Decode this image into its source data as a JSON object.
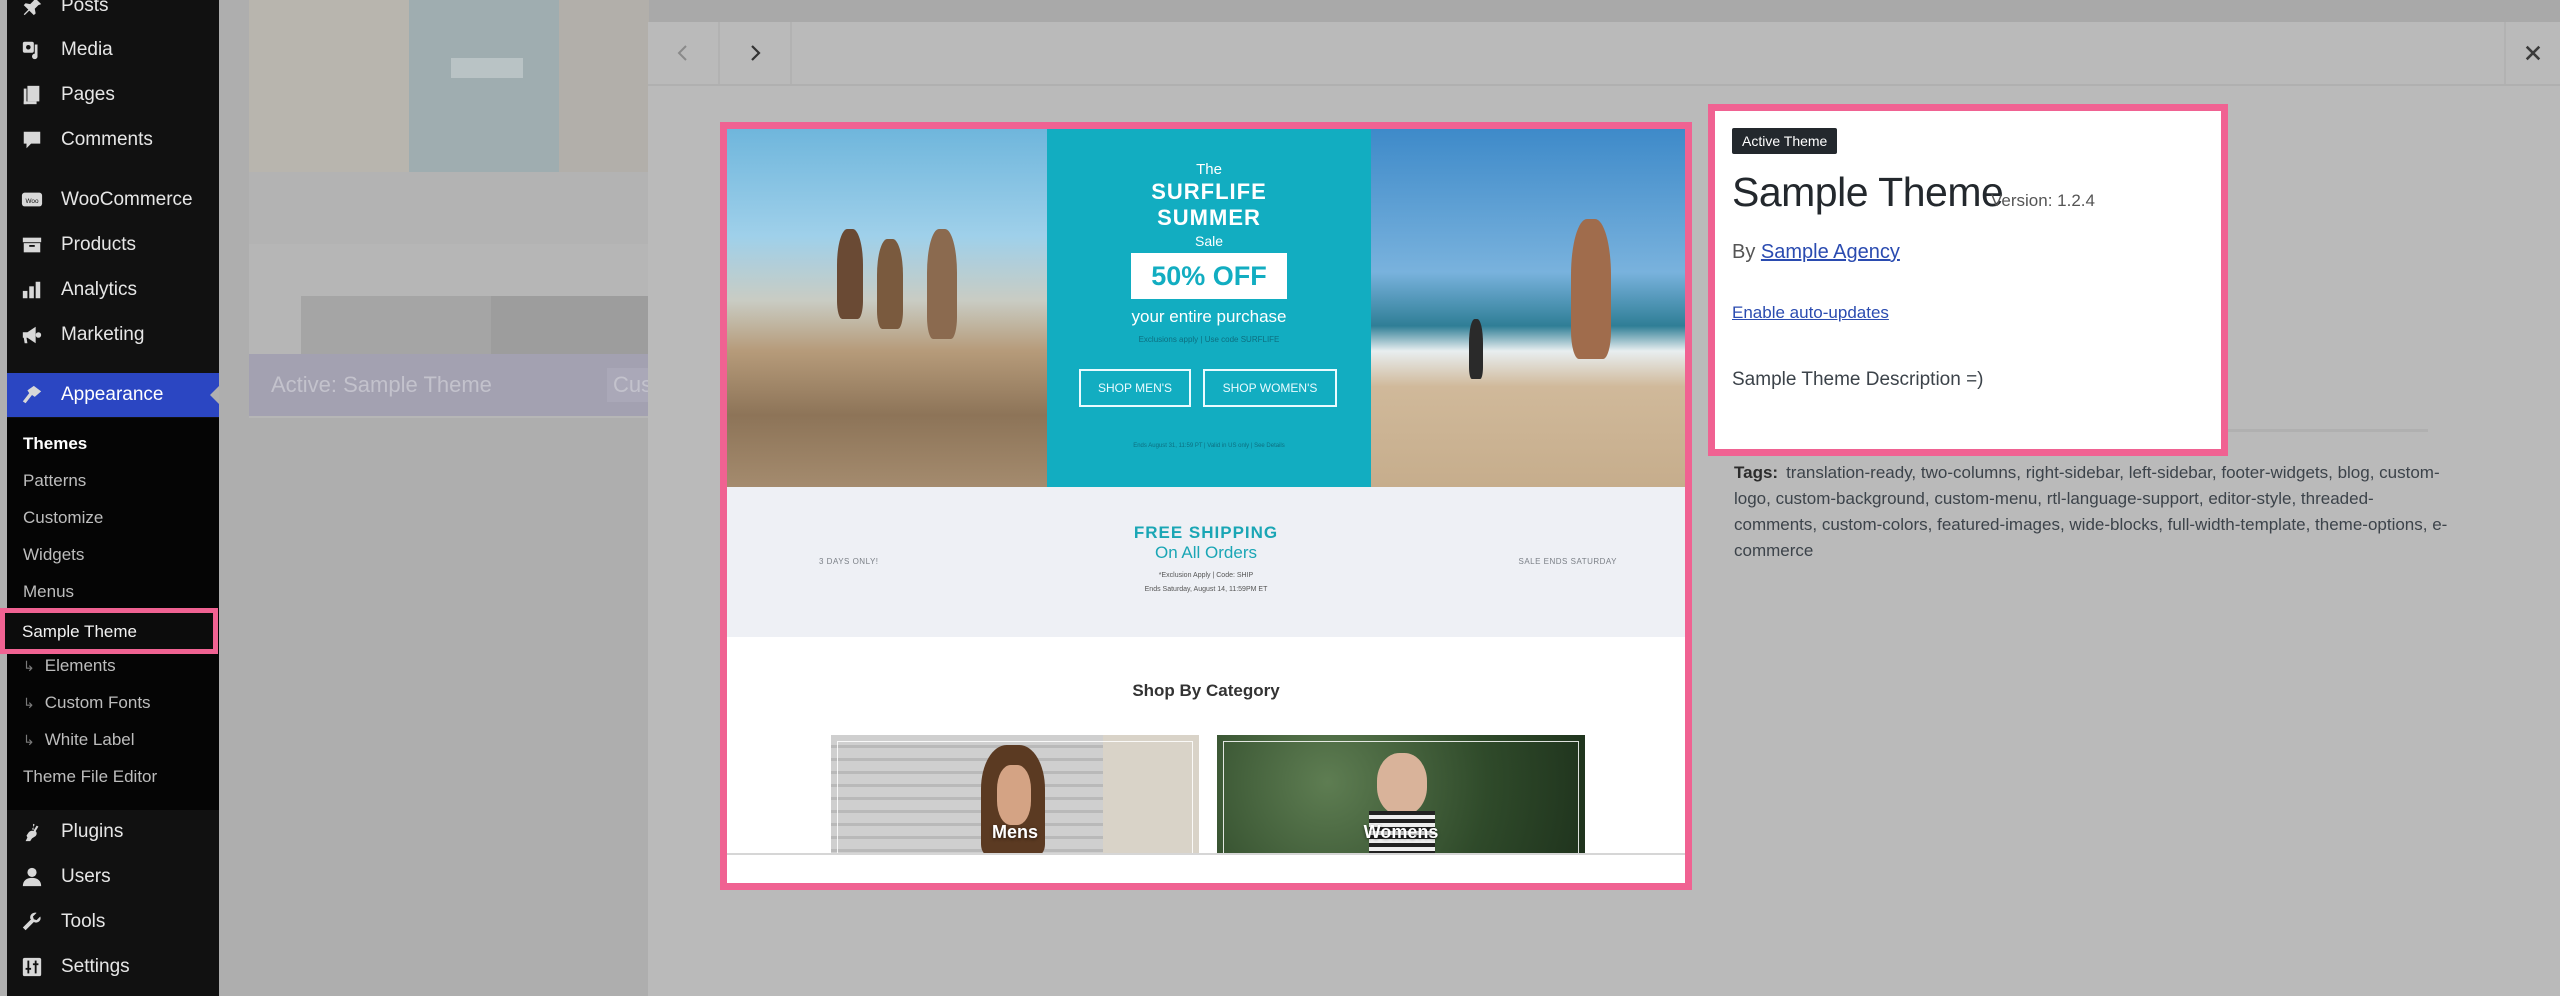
{
  "sidebar": {
    "items": [
      {
        "label": "Posts",
        "icon": "pin-icon"
      },
      {
        "label": "Media",
        "icon": "media-icon"
      },
      {
        "label": "Pages",
        "icon": "pages-icon"
      },
      {
        "label": "Comments",
        "icon": "comment-icon"
      },
      {
        "label": "WooCommerce",
        "icon": "woo-icon"
      },
      {
        "label": "Products",
        "icon": "archive-icon"
      },
      {
        "label": "Analytics",
        "icon": "bar-chart-icon"
      },
      {
        "label": "Marketing",
        "icon": "megaphone-icon"
      },
      {
        "label": "Appearance",
        "icon": "paintbrush-icon"
      },
      {
        "label": "Plugins",
        "icon": "plug-icon"
      },
      {
        "label": "Users",
        "icon": "user-icon"
      },
      {
        "label": "Tools",
        "icon": "wrench-icon"
      },
      {
        "label": "Settings",
        "icon": "sliders-icon"
      }
    ],
    "submenu": [
      {
        "label": "Themes"
      },
      {
        "label": "Patterns"
      },
      {
        "label": "Customize"
      },
      {
        "label": "Widgets"
      },
      {
        "label": "Menus"
      },
      {
        "label": "Sample Theme"
      },
      {
        "label": "Elements",
        "hook": "↳"
      },
      {
        "label": "Custom Fonts",
        "hook": "↳"
      },
      {
        "label": "White Label",
        "hook": "↳"
      },
      {
        "label": "Theme File Editor"
      }
    ]
  },
  "background": {
    "card_title": "Active: Sample Theme",
    "card_button": "Customize"
  },
  "modal": {
    "prev_icon": "chevron-left-icon",
    "next_icon": "chevron-right-icon",
    "close_icon": "close-icon",
    "preview": {
      "hero": {
        "line1": "The",
        "line2": "SURFLIFE",
        "line3": "SUMMER",
        "line4": "Sale",
        "offer": "50% OFF",
        "subline": "your entire purchase",
        "exclusions": "Exclusions apply | Use code SURFLIFE",
        "shop_mens": "SHOP MEN'S",
        "shop_womens": "SHOP WOMEN'S",
        "ends": "Ends August 31, 11:59 PT | Valid in US only | See Details"
      },
      "shipping": {
        "left": "3 DAYS ONLY!",
        "title": "FREE SHIPPING",
        "subtitle": "On All Orders",
        "note1": "*Exclusion Apply | Code: SHIP",
        "note2": "Ends Saturday, August 14, 11:59PM ET",
        "right": "SALE ENDS SATURDAY"
      },
      "category_title": "Shop By Category",
      "categories": [
        {
          "label": "Mens"
        },
        {
          "label": "Womens"
        }
      ]
    },
    "details": {
      "badge": "Active Theme",
      "name": "Sample Theme",
      "version": "Version: 1.2.4",
      "author_prefix": "By",
      "author": "Sample Agency",
      "auto_updates": "Enable auto-updates",
      "description": "Sample Theme Description =)",
      "tags_label": "Tags:",
      "tags": "translation-ready, two-columns, right-sidebar, left-sidebar, footer-widgets, blog, custom-logo, custom-background, custom-menu, rtl-language-support, editor-style, threaded-comments, custom-colors, featured-images, wide-blocks, full-width-template, theme-options, e-commerce"
    }
  },
  "colors": {
    "highlight": "#f06292",
    "wp_admin_blue": "#2b46c2",
    "promo_teal": "#12adc1",
    "link": "#2a4bb0"
  }
}
